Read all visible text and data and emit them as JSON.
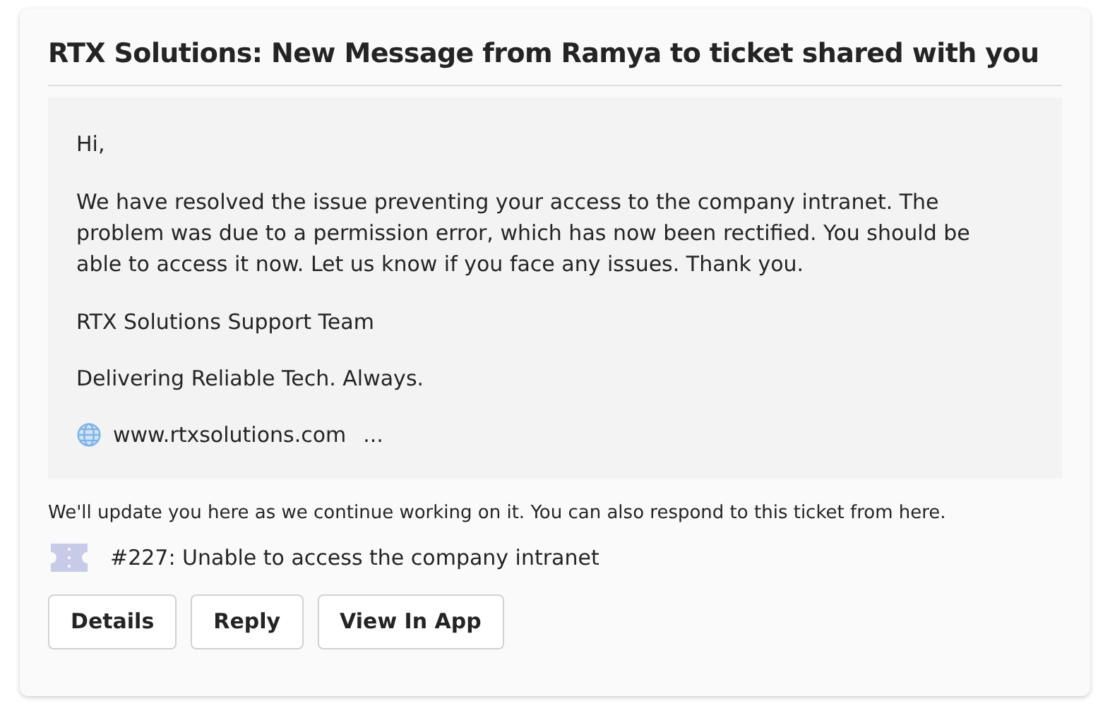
{
  "card": {
    "title": "RTX Solutions: New Message from Ramya to ticket shared with you",
    "message": {
      "greeting": "Hi,",
      "body": "We have resolved the issue preventing your access to the company intranet. The problem was due to a permission error, which has now been rectified. You should be able to access it now. Let us know if you face any issues. Thank you.",
      "signature": "RTX Solutions Support Team",
      "tagline": "Delivering Reliable Tech. Always.",
      "website": "www.rtxsolutions.com",
      "more": "..."
    },
    "note": "We'll update you here as we continue working on it. You can also respond to this ticket from here.",
    "ticket": "#227: Unable to access the company intranet",
    "buttons": [
      "Details",
      "Reply",
      "View In App"
    ]
  }
}
